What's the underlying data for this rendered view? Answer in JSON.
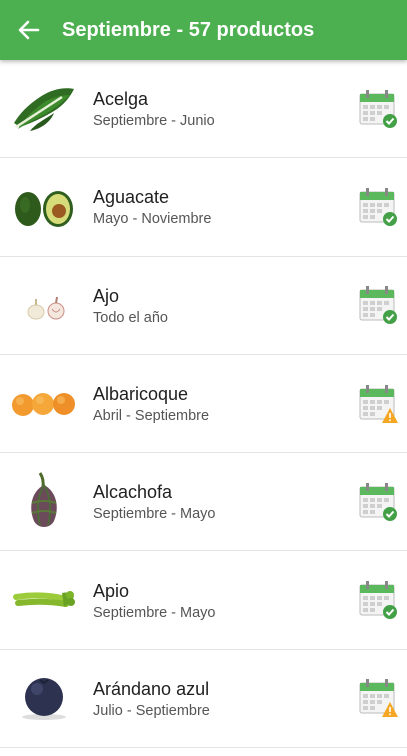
{
  "header": {
    "title": "Septiembre - 57 productos",
    "back_icon": "arrow-left-icon",
    "color": "#4caf50"
  },
  "items": [
    {
      "name": "Acelga",
      "season": "Septiembre - Junio",
      "image": "chard",
      "status": "in-season"
    },
    {
      "name": "Aguacate",
      "season": "Mayo - Noviembre",
      "image": "avocado",
      "status": "in-season"
    },
    {
      "name": "Ajo",
      "season": "Todo el año",
      "image": "garlic",
      "status": "in-season"
    },
    {
      "name": "Albaricoque",
      "season": "Abril - Septiembre",
      "image": "apricot",
      "status": "ending"
    },
    {
      "name": "Alcachofa",
      "season": "Septiembre - Mayo",
      "image": "artichoke",
      "status": "in-season"
    },
    {
      "name": "Apio",
      "season": "Septiembre - Mayo",
      "image": "celery",
      "status": "in-season"
    },
    {
      "name": "Arándano azul",
      "season": "Julio - Septiembre",
      "image": "blueberry",
      "status": "ending"
    }
  ],
  "status_colors": {
    "in-season": "#43a047",
    "ending": "#f5a623"
  }
}
